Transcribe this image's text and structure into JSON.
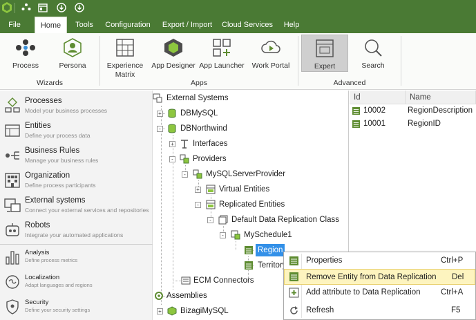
{
  "colors": {
    "brand_green": "#4a7a34",
    "icon_green": "#5e8c31",
    "selection_blue": "#3390e8",
    "highlight": "#fdf4bf"
  },
  "quick_access": [
    {
      "icon": "bizagi-logo-icon"
    },
    {
      "icon": "dots-icon"
    },
    {
      "icon": "window-icon"
    },
    {
      "icon": "download-icon"
    },
    {
      "icon": "download-icon"
    }
  ],
  "menu": {
    "tabs": [
      "File",
      "Home",
      "Tools",
      "Configuration",
      "Export / Import",
      "Cloud Services",
      "Help"
    ],
    "active": "Home"
  },
  "ribbon": {
    "wizards": {
      "label": "Wizards",
      "buttons": [
        {
          "label": "Process",
          "icon": "process-icon"
        },
        {
          "label": "Persona",
          "icon": "persona-icon"
        }
      ]
    },
    "apps": {
      "label": "Apps",
      "buttons": [
        {
          "label": "Experience",
          "label2": "Matrix",
          "icon": "matrix-icon"
        },
        {
          "label": "App Designer",
          "icon": "app-designer-icon"
        },
        {
          "label": "App Launcher",
          "icon": "app-launcher-icon"
        },
        {
          "label": "Work Portal",
          "icon": "work-portal-icon"
        }
      ]
    },
    "advanced": {
      "label": "Advanced",
      "buttons": [
        {
          "label": "Expert",
          "icon": "expert-icon",
          "selected": true
        },
        {
          "label": "Search",
          "icon": "search-icon"
        }
      ]
    }
  },
  "nav": [
    {
      "title": "Processes",
      "desc": "Model your business processes",
      "icon": "processes-icon"
    },
    {
      "title": "Entities",
      "desc": "Define your process data",
      "icon": "entities-icon"
    },
    {
      "title": "Business Rules",
      "desc": "Manage your business rules",
      "icon": "business-rules-icon"
    },
    {
      "title": "Organization",
      "desc": "Define process participants",
      "icon": "organization-icon"
    },
    {
      "title": "External systems",
      "desc": "Connect your external services and repositories",
      "icon": "external-systems-icon"
    },
    {
      "title": "Robots",
      "desc": "Integrate your automated applications",
      "icon": "robots-icon"
    },
    {
      "title": "Analysis",
      "desc": "Define process metrics",
      "icon": "analysis-icon"
    },
    {
      "title": "Localization",
      "desc": "Adapt languages and regions",
      "icon": "localization-icon"
    },
    {
      "title": "Security",
      "desc": "Define your security settings",
      "icon": "security-icon"
    }
  ],
  "tree": [
    {
      "label": "External Systems",
      "icon": "external-systems-icon"
    },
    {
      "label": "DBMySQL",
      "icon": "database-icon",
      "exp": "+"
    },
    {
      "label": "DBNorthwind",
      "icon": "database-icon",
      "exp": "-"
    },
    {
      "label": "Interfaces",
      "icon": "interface-icon",
      "exp": "+"
    },
    {
      "label": "Providers",
      "icon": "providers-icon",
      "exp": "-"
    },
    {
      "label": "MySQLServerProvider",
      "icon": "provider-icon",
      "exp": "-"
    },
    {
      "label": "Virtual Entities",
      "icon": "virtual-entities-icon",
      "exp": "+"
    },
    {
      "label": "Replicated Entities",
      "icon": "replicated-entities-icon",
      "exp": "-"
    },
    {
      "label": "Default Data Replication Class",
      "icon": "replication-class-icon",
      "exp": "-"
    },
    {
      "label": "MySchedule1",
      "icon": "schedule-icon",
      "exp": "-"
    },
    {
      "label": "Region",
      "icon": "entity-icon",
      "selected": true
    },
    {
      "label": "Territory",
      "icon": "entity-icon"
    },
    {
      "label": "ECM Connectors",
      "icon": "ecm-icon"
    },
    {
      "label": "Assemblies",
      "icon": "assemblies-icon"
    },
    {
      "label": "BizagiMySQL",
      "icon": "assembly-icon",
      "exp": "+"
    }
  ],
  "grid": {
    "headers": [
      "Id",
      "Name"
    ],
    "rows": [
      {
        "id": "10002",
        "name": "RegionDescription"
      },
      {
        "id": "10001",
        "name": "RegionID"
      }
    ]
  },
  "context_menu": [
    {
      "label": "Properties",
      "shortcut": "Ctrl+P",
      "icon": "properties-icon"
    },
    {
      "label": "Remove Entity from Data Replication",
      "shortcut": "Del",
      "icon": "remove-entity-icon",
      "highlighted": true
    },
    {
      "label": "Add attribute to Data Replication",
      "shortcut": "Ctrl+A",
      "icon": "add-attribute-icon"
    },
    {
      "label": "Refresh",
      "shortcut": "F5",
      "icon": "refresh-icon"
    }
  ]
}
